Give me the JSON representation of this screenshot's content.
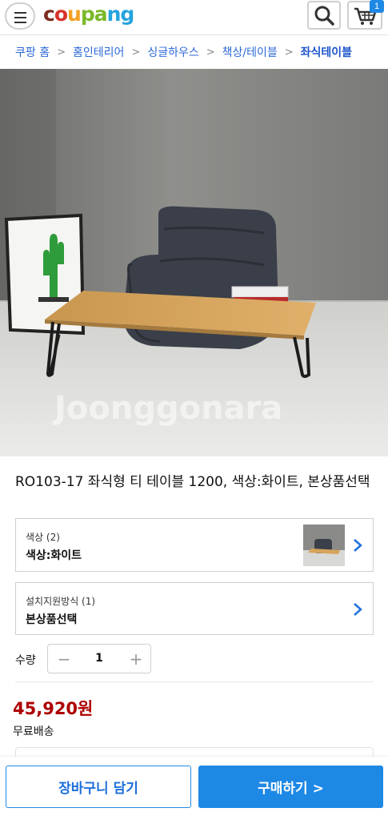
{
  "header": {
    "logo": {
      "c": "c",
      "o": "o",
      "u": "u",
      "p": "p",
      "a": "a",
      "n": "n",
      "g": "g"
    },
    "cart_count": "1",
    "icons": {
      "menu": "hamburger-icon",
      "search": "search-icon",
      "cart": "cart-icon"
    }
  },
  "breadcrumb": {
    "items": [
      "쿠팡 홈",
      "홈인테리어",
      "싱글하우스",
      "책상/테이블",
      "좌식테이블"
    ],
    "separator": ">"
  },
  "product": {
    "watermark": "Joonggonara",
    "title": "RO103-17 좌식형 티 테이블 1200, 색상:화이트, 본상품선택"
  },
  "options": [
    {
      "label": "색상 (2)",
      "value": "색상:화이트"
    },
    {
      "label": "설치지원방식 (1)",
      "value": "본상품선택"
    }
  ],
  "quantity": {
    "label": "수량",
    "value": "1",
    "minus": "−",
    "plus": "+"
  },
  "price": {
    "amount": "45,920원",
    "shipping": "무료배송"
  },
  "actions": {
    "add_to_cart": "장바구니 담기",
    "buy_now": "구매하기 >"
  },
  "colors": {
    "accent": "#1e88e5",
    "price": "#ae0000",
    "link": "#2c68d8"
  }
}
